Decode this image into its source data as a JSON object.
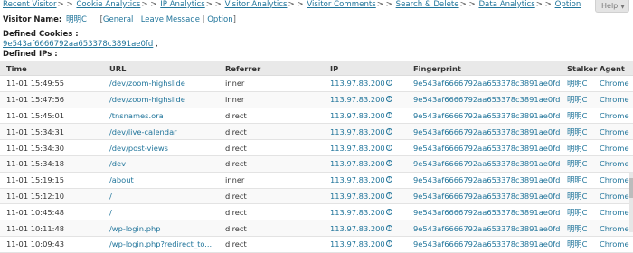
{
  "nav": {
    "items": [
      "Recent Visitor",
      "Cookie Analytics",
      "IP Analytics",
      "Visitor Analytics",
      "Visitor Comments",
      "Search & Delete",
      "Data Analytics",
      "Option"
    ],
    "separator": "> >"
  },
  "help_label": "Help",
  "visitor": {
    "label": "Visitor Name:",
    "name": "明明C",
    "links": [
      "General",
      "Leave Message",
      "Option"
    ]
  },
  "cookies": {
    "label": "Defined Cookies :",
    "value": "9e543af6666792aa653378c3891ae0fd",
    "suffix": ","
  },
  "ips_label": "Defined IPs :",
  "table": {
    "columns": [
      "Time",
      "URL",
      "Referrer",
      "IP",
      "Fingerprint",
      "Stalker",
      "Agent"
    ],
    "rows": [
      [
        "11-01 15:49:55",
        "/dev/zoom-highslide",
        "inner",
        "113.97.83.200",
        "9e543af6666792aa653378c3891ae0fd",
        "明明C",
        "Chrome"
      ],
      [
        "11-01 15:47:56",
        "/dev/zoom-highslide",
        "inner",
        "113.97.83.200",
        "9e543af6666792aa653378c3891ae0fd",
        "明明C",
        "Chrome"
      ],
      [
        "11-01 15:45:01",
        "/tnsnames.ora",
        "direct",
        "113.97.83.200",
        "9e543af6666792aa653378c3891ae0fd",
        "明明C",
        "Chrome"
      ],
      [
        "11-01 15:34:31",
        "/dev/live-calendar",
        "direct",
        "113.97.83.200",
        "9e543af6666792aa653378c3891ae0fd",
        "明明C",
        "Chrome"
      ],
      [
        "11-01 15:34:30",
        "/dev/post-views",
        "direct",
        "113.97.83.200",
        "9e543af6666792aa653378c3891ae0fd",
        "明明C",
        "Chrome"
      ],
      [
        "11-01 15:34:18",
        "/dev",
        "direct",
        "113.97.83.200",
        "9e543af6666792aa653378c3891ae0fd",
        "明明C",
        "Chrome"
      ],
      [
        "11-01 15:19:15",
        "/about",
        "inner",
        "113.97.83.200",
        "9e543af6666792aa653378c3891ae0fd",
        "明明C",
        "Chrome"
      ],
      [
        "11-01 15:12:10",
        "/",
        "direct",
        "113.97.83.200",
        "9e543af6666792aa653378c3891ae0fd",
        "明明C",
        "Chrome"
      ],
      [
        "11-01 10:45:48",
        "/",
        "direct",
        "113.97.83.200",
        "9e543af6666792aa653378c3891ae0fd",
        "明明C",
        "Chrome"
      ],
      [
        "11-01 10:11:48",
        "/wp-login.php",
        "direct",
        "113.97.83.200",
        "9e543af6666792aa653378c3891ae0fd",
        "明明C",
        "Chrome"
      ],
      [
        "11-01 10:09:43",
        "/wp-login.php?redirect_to...",
        "direct",
        "113.97.83.200",
        "9e543af6666792aa653378c3891ae0fd",
        "明明C",
        "Chrome"
      ]
    ]
  }
}
